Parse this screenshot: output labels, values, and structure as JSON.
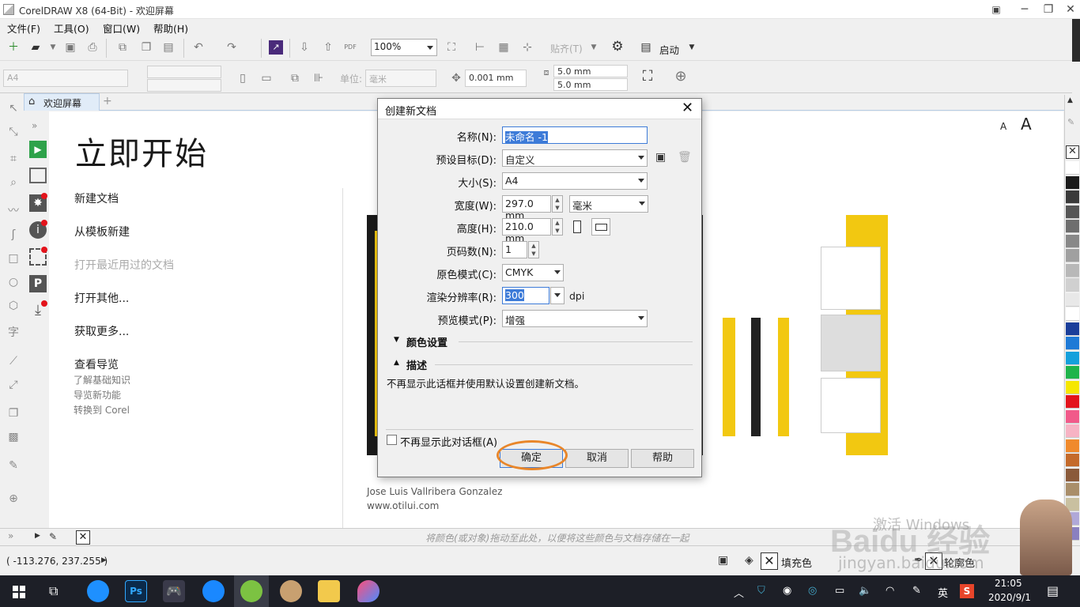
{
  "window": {
    "title": "CorelDRAW X8 (64-Bit) - 欢迎屏幕"
  },
  "menubar": {
    "items": [
      "文件(F)",
      "工具(O)",
      "窗口(W)",
      "帮助(H)"
    ]
  },
  "toolbar": {
    "zoom": "100%",
    "paste_label": "贴齐(T)",
    "launch_label": "启动"
  },
  "propbar": {
    "page_size": "A4",
    "unit_label": "单位:",
    "unit_value": "毫米",
    "nudge": "0.001 mm",
    "dup_x": "5.0 mm",
    "dup_y": "5.0 mm"
  },
  "tab": {
    "label": "欢迎屏幕"
  },
  "welcome": {
    "title": "立即开始",
    "links": [
      "新建文档",
      "从模板新建",
      "打开最近用过的文档",
      "打开其他...",
      "获取更多..."
    ],
    "guide_title": "查看导览",
    "guide_items": [
      "了解基础知识",
      "导览新功能",
      "转换到 Corel"
    ],
    "credit_name": "Jose Luis Vallribera Gonzalez",
    "credit_url": "www.otilui.com"
  },
  "docbar": {
    "hint": "将颜色(或对象)拖动至此处，以便将这些颜色与文档存储在一起"
  },
  "statusbar": {
    "coords": "( -113.276, 237.255 )",
    "fill_label": "填充色",
    "outline_label": "轮廓色"
  },
  "watermark": {
    "activate": "激活 Windows",
    "site": "jingyan.baidu.com",
    "logo": "Baidu 经验"
  },
  "dialog": {
    "title": "创建新文档",
    "name_label": "名称(N):",
    "name_value": "未命名 -1",
    "preset_label": "预设目标(D):",
    "preset_value": "自定义",
    "size_label": "大小(S):",
    "size_value": "A4",
    "width_label": "宽度(W):",
    "width_value": "297.0 mm",
    "unit_value": "毫米",
    "height_label": "高度(H):",
    "height_value": "210.0 mm",
    "pages_label": "页码数(N):",
    "pages_value": "1",
    "color_mode_label": "原色模式(C):",
    "color_mode_value": "CMYK",
    "resolution_label": "渲染分辨率(R):",
    "resolution_value": "300",
    "resolution_unit": "dpi",
    "preview_label": "预览模式(P):",
    "preview_value": "增强",
    "color_settings": "颜色设置",
    "description_title": "描述",
    "description_text": "不再显示此话框并使用默认设置创建新文档。",
    "dont_show": "不再显示此对话框(A)",
    "ok": "确定",
    "cancel": "取消",
    "help": "帮助"
  },
  "taskbar": {
    "time": "21:05",
    "date": "2020/9/1",
    "ime": "英"
  },
  "colors": {
    "accent_highlight": "#e8862a",
    "palette": [
      "#ffffff",
      "#1a1a1a",
      "#3a3a3a",
      "#555555",
      "#6e6e6e",
      "#888888",
      "#a0a0a0",
      "#b8b8b8",
      "#d0d0d0",
      "#e8e8e8",
      "#ffffff",
      "#1a3e9a",
      "#1e7ad6",
      "#14a0dc",
      "#1fb44b",
      "#f6e700",
      "#e3131b",
      "#f15a8a",
      "#f7b3c4",
      "#f08a2c",
      "#c46a2a",
      "#8a5a3a",
      "#a98e6a",
      "#c9c0a0",
      "#b0a8d8",
      "#8a80c0"
    ]
  }
}
